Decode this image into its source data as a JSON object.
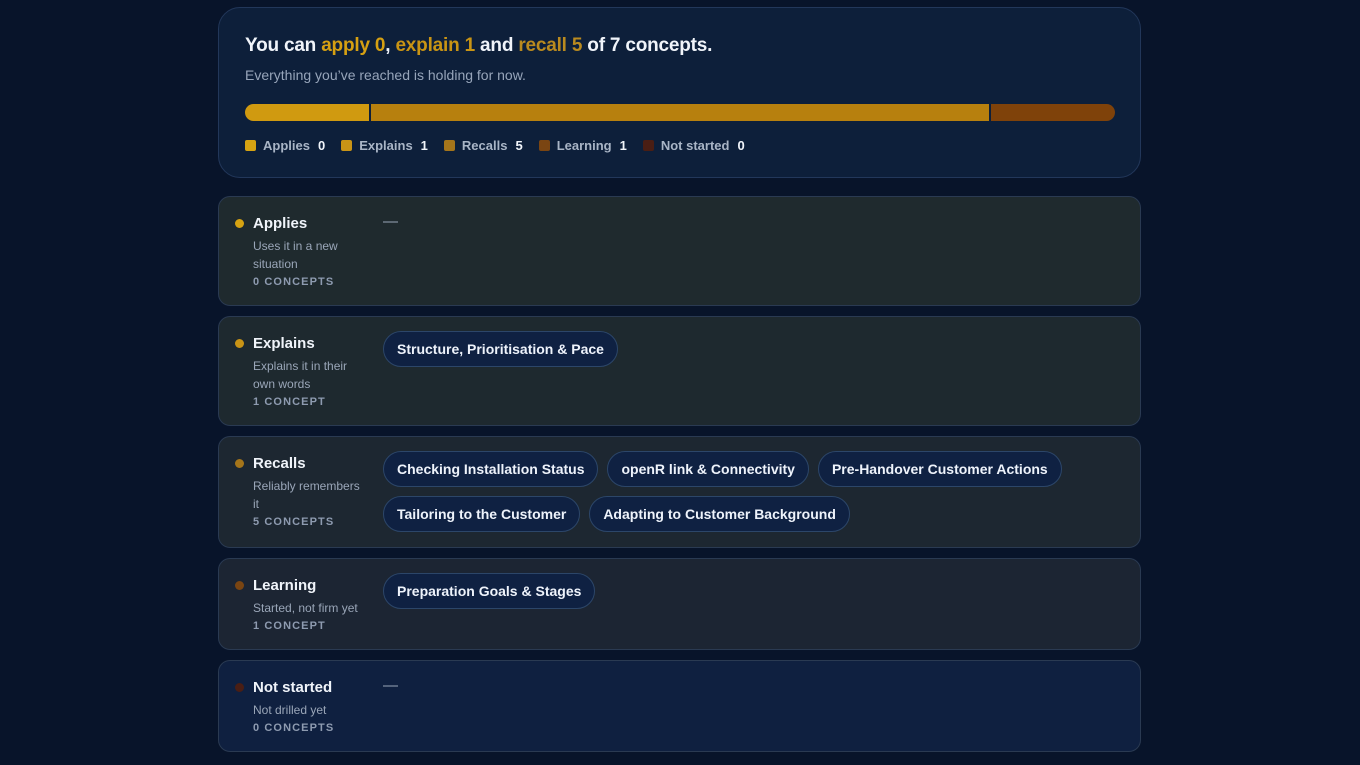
{
  "summary": {
    "headline": {
      "prefix": "You can ",
      "apply": "apply 0",
      "sep1": ", ",
      "explain": "explain 1",
      "sep2": " and ",
      "recall": "recall 5",
      "suffix": " of 7 concepts."
    },
    "subtitle": "Everything you’ve reached is holding for now.",
    "progress": [
      {
        "key": "recalls_from_explains",
        "name": "Explains",
        "fraction": 0.1429,
        "color": "#d09a10"
      },
      {
        "key": "recalls",
        "name": "Recalls",
        "fraction": 0.7143,
        "color": "#b7800e"
      },
      {
        "key": "learning",
        "name": "Learning",
        "fraction": 0.1429,
        "color": "#7f420a"
      }
    ],
    "legend": [
      {
        "label": "Applies",
        "count": "0",
        "color": "#d6a312"
      },
      {
        "label": "Explains",
        "count": "1",
        "color": "#c99416"
      },
      {
        "label": "Recalls",
        "count": "5",
        "color": "#a5751a"
      },
      {
        "label": "Learning",
        "count": "1",
        "color": "#7a4512"
      },
      {
        "label": "Not started",
        "count": "0",
        "color": "#4a1e14"
      }
    ]
  },
  "levels": [
    {
      "title": "Applies",
      "desc": "Uses it in a new situation",
      "count": "0 CONCEPTS",
      "dot_color": "#d6a312",
      "bg": "#1f2a2e",
      "chips": [],
      "empty": "—"
    },
    {
      "title": "Explains",
      "desc": "Explains it in their own words",
      "count": "1 CONCEPT",
      "dot_color": "#c99416",
      "bg": "#1e292f",
      "chips": [
        "Structure, Prioritisation & Pace"
      ],
      "empty": ""
    },
    {
      "title": "Recalls",
      "desc": "Reliably remembers it",
      "count": "5 CONCEPTS",
      "dot_color": "#a5751a",
      "bg": "#1d2731",
      "chips": [
        "Checking Installation Status",
        "openR link & Connectivity",
        "Pre-Handover Customer Actions",
        "Tailoring to the Customer",
        "Adapting to Customer Background"
      ],
      "empty": ""
    },
    {
      "title": "Learning",
      "desc": "Started, not firm yet",
      "count": "1 CONCEPT",
      "dot_color": "#7a4512",
      "bg": "#1c2533",
      "chips": [
        "Preparation Goals & Stages"
      ],
      "empty": ""
    },
    {
      "title": "Not started",
      "desc": "Not drilled yet",
      "count": "0 CONCEPTS",
      "dot_color": "#4a1e14",
      "bg": "#0f2040",
      "chips": [],
      "empty": "—"
    }
  ]
}
